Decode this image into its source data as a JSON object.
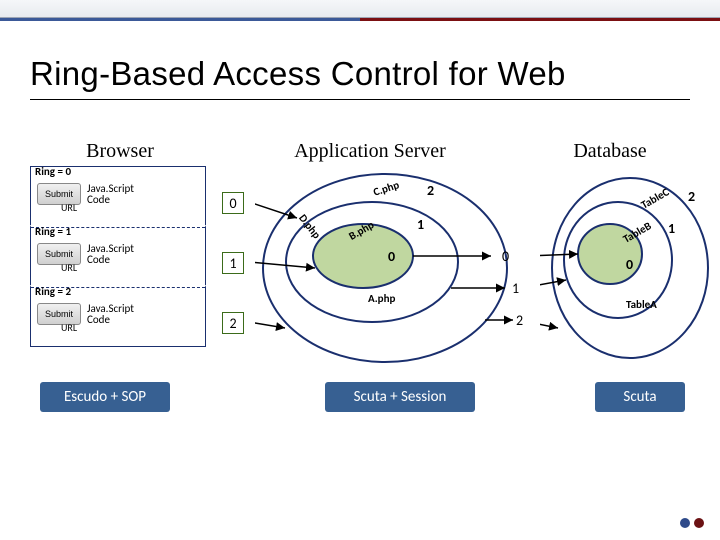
{
  "title": "Ring-Based Access Control for Web",
  "columns": {
    "browser": "Browser",
    "app": "Application Server",
    "db": "Database"
  },
  "browser_rings": [
    {
      "label": "Ring = 0",
      "submit": "Submit",
      "js": "Java.Script",
      "code": "Code",
      "url": "URL"
    },
    {
      "label": "Ring = 1",
      "submit": "Submit",
      "js": "Java.Script",
      "code": "Code",
      "url": "URL"
    },
    {
      "label": "Ring = 2",
      "submit": "Submit",
      "js": "Java.Script",
      "code": "Code",
      "url": "URL"
    }
  ],
  "arrow_nums": {
    "n0": "0",
    "n1": "1",
    "n2": "2"
  },
  "app_rings": {
    "outer_num": "2",
    "mid_num": "1",
    "inner_num": "0",
    "labels": {
      "c": "C.php",
      "b": "B.php",
      "d": "D.php",
      "a": "A.php"
    },
    "right_nums": {
      "r0": "0",
      "r1": "1",
      "r2": "2"
    }
  },
  "db_rings": {
    "outer_num": "2",
    "mid_num": "1",
    "inner_num": "0",
    "labels": {
      "c": "TableC",
      "b": "TableB",
      "a": "TableA"
    }
  },
  "bottom": {
    "browser": "Escudo + SOP",
    "app": "Scuta + Session",
    "db": "Scuta"
  }
}
